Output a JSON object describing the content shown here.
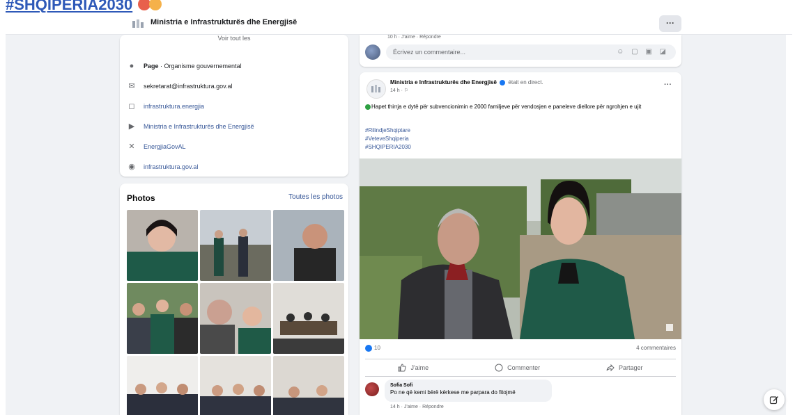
{
  "top_hashtag": "#SHQIPERIA2030",
  "topbar": {
    "page_name": "Ministria e Infrastrukturës dhe Energjisë",
    "more_label": "···"
  },
  "intro": {
    "cut_text": "Voir tout les",
    "items": [
      {
        "icon": "info-icon",
        "label_bold": "Page",
        "label": " · Organisme gouvernemental",
        "link": false
      },
      {
        "icon": "email-icon",
        "label": "sekretarat@infrastruktura.gov.al",
        "link": false
      },
      {
        "icon": "instagram-icon",
        "label": "infrastruktura.energjia",
        "link": true
      },
      {
        "icon": "youtube-icon",
        "label": "Ministria e Infrastrukturës dhe Energjisë",
        "link": true
      },
      {
        "icon": "x-icon",
        "label": "EnergjiaGovAL",
        "link": true
      },
      {
        "icon": "globe-icon",
        "label": "infrastruktura.gov.al",
        "link": true
      }
    ]
  },
  "photos": {
    "title": "Photos",
    "see_all": "Toutes les photos"
  },
  "comment_top": {
    "links": "10 h · J'aime · Répondre",
    "placeholder": "Écrivez un commentaire...",
    "tools": "☺ ▢ ▣ ◪"
  },
  "post": {
    "author": "Ministria e Infrastrukturës dhe Energjisë",
    "live_label": "était en direct.",
    "time": "14 h · ⚐",
    "more": "···",
    "text": "Hapet thirrja e dytë për subvencionimin e 2000 familjeve për vendosjen e paneleve diellore për ngrohjen e ujit",
    "tags": [
      "#RilindjeShqiptare",
      "#VeteveShqiperia",
      "#SHQIPERIA2030"
    ],
    "reactions": "10",
    "comments": "4 commentaires",
    "actions": {
      "like": "J'aime",
      "comment": "Commenter",
      "share": "Partager"
    }
  },
  "comment": {
    "name": "Sofia Sofi",
    "text": "Po ne që kemi bërë kërkese me parpara do fitojmë",
    "meta": "14 h · J'aime · Répondre"
  },
  "colors": {
    "accent": "#1877f2",
    "link": "#385898",
    "background": "#f0f2f5"
  }
}
